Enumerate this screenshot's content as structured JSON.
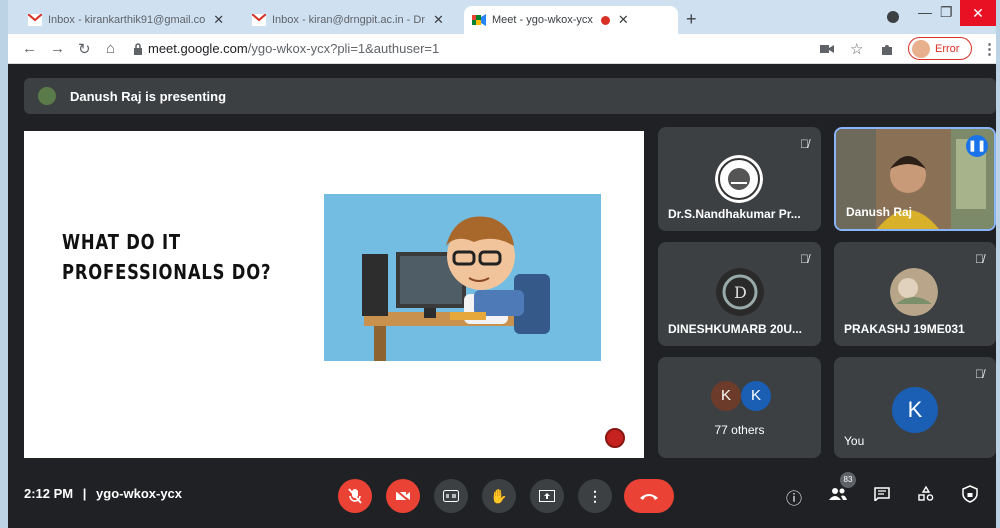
{
  "browser": {
    "tabs": [
      {
        "title": "Inbox - kirankarthik91@gmail.co",
        "close": "✕"
      },
      {
        "title": "Inbox - kiran@drngpit.ac.in - Dr",
        "close": "✕"
      },
      {
        "title": "Meet - ygo-wkox-ycx",
        "close": "✕"
      }
    ],
    "new_tab": "+",
    "url_host": "meet.google.com",
    "url_path": "/ygo-wkox-ycx?pli=1&authuser=1",
    "profile_label": "Error",
    "window_controls": {
      "minimize": "—",
      "maximize": "❐",
      "close": "✕"
    }
  },
  "meet": {
    "presenting_banner": "Danush Raj is presenting",
    "slide": {
      "title_line1": "WHAT DO IT",
      "title_line2": "PROFESSIONALS DO?"
    },
    "participants": [
      {
        "name": "Dr.S.Nandhakumar Pr...",
        "muted": true
      },
      {
        "name": "Danush Raj",
        "muted": false,
        "speaking": true
      },
      {
        "name": "DINESHKUMARB 20U...",
        "muted": true
      },
      {
        "name": "PRAKASHJ 19ME031",
        "muted": true
      },
      {
        "name": "77 others",
        "initials": [
          "K",
          "K"
        ]
      },
      {
        "name": "You",
        "initial": "K",
        "muted": true
      }
    ],
    "time": "2:12 PM",
    "separator": "|",
    "meeting_code": "ygo-wkox-ycx",
    "people_count": "83"
  },
  "colors": {
    "red": "#ea4335",
    "meet_bg": "#202124",
    "tile_bg": "#3c4043",
    "accent_blue": "#1a73e8"
  }
}
